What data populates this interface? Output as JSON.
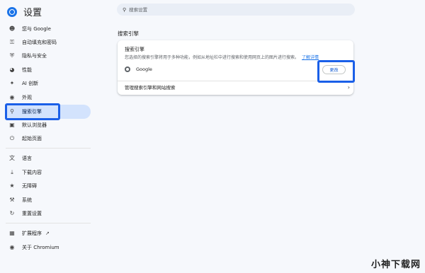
{
  "app": {
    "title": "设置"
  },
  "search": {
    "placeholder": "搜索设置"
  },
  "sidebar": {
    "items": [
      {
        "label": "您与 Google",
        "icon": "person-icon"
      },
      {
        "label": "自动填充和密码",
        "icon": "key-icon"
      },
      {
        "label": "隐私与安全",
        "icon": "shield-icon"
      },
      {
        "label": "性能",
        "icon": "speedometer-icon"
      },
      {
        "label": "AI 创新",
        "icon": "sparkle-icon"
      },
      {
        "label": "外观",
        "icon": "palette-icon"
      },
      {
        "label": "搜索引擎",
        "icon": "search-icon"
      },
      {
        "label": "默认浏览器",
        "icon": "browser-icon"
      },
      {
        "label": "起始页面",
        "icon": "power-icon"
      },
      {
        "label": "语言",
        "icon": "translate-icon"
      },
      {
        "label": "下载内容",
        "icon": "download-icon"
      },
      {
        "label": "无障碍",
        "icon": "accessibility-icon"
      },
      {
        "label": "系统",
        "icon": "wrench-icon"
      },
      {
        "label": "重置设置",
        "icon": "reset-icon"
      },
      {
        "label": "扩展程序",
        "icon": "puzzle-icon"
      },
      {
        "label": "关于 Chromium",
        "icon": "chromium-icon"
      }
    ]
  },
  "main": {
    "section_title": "搜索引擎",
    "card": {
      "title": "搜索引擎",
      "description": "您选择的搜索引擎将用于多种功能，例如从地址栏中进行搜索和使用网页上的图片进行搜索。",
      "learn_more": "了解详情",
      "engine": "Google",
      "change_button": "更改",
      "manage_label": "管理搜索引擎和网站搜索"
    }
  },
  "watermark": "小神下载网",
  "colors": {
    "accent": "#1a73e8",
    "highlight": "#1a5fe8",
    "active_bg": "#d3e3fd"
  }
}
